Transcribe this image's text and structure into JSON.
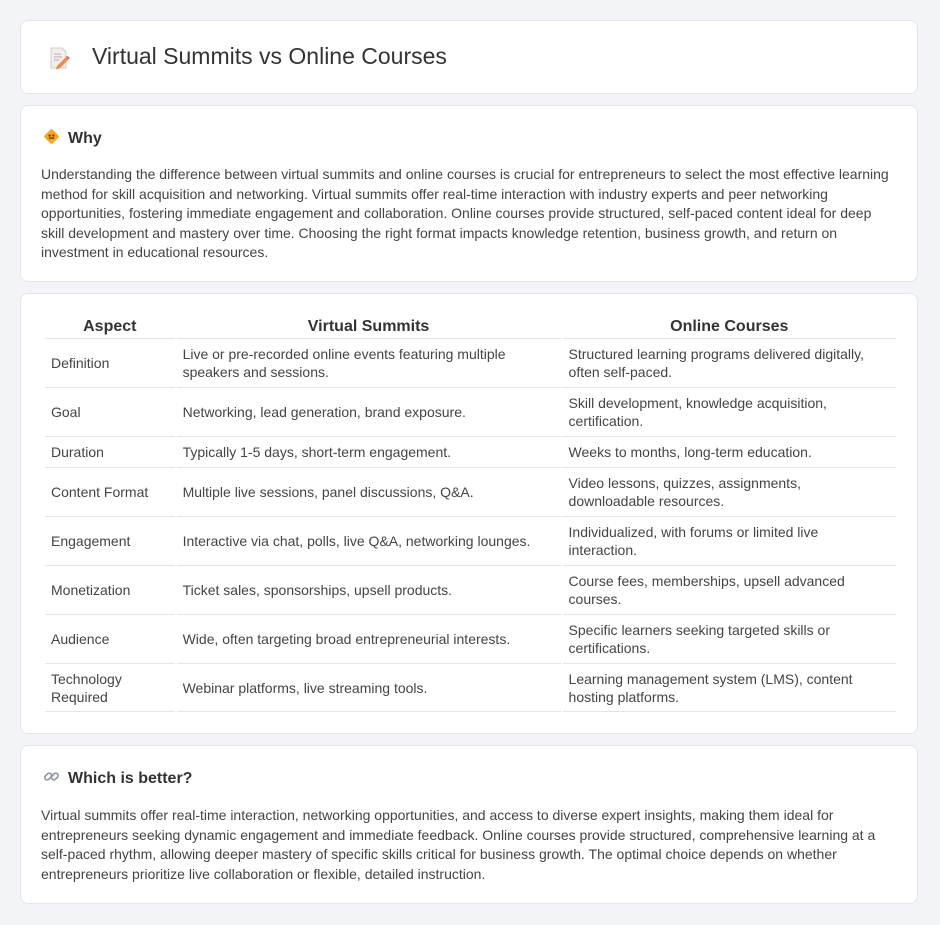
{
  "header": {
    "title": "Virtual Summits vs Online Courses",
    "icon": "document-pencil-icon"
  },
  "why": {
    "heading": "Why",
    "icon": "diamond-sign-icon",
    "text": "Understanding the difference between virtual summits and online courses is crucial for entrepreneurs to select the most effective learning method for skill acquisition and networking. Virtual summits offer real-time interaction with industry experts and peer networking opportunities, fostering immediate engagement and collaboration. Online courses provide structured, self-paced content ideal for deep skill development and mastery over time. Choosing the right format impacts knowledge retention, business growth, and return on investment in educational resources."
  },
  "table": {
    "headers": [
      "Aspect",
      "Virtual Summits",
      "Online Courses"
    ],
    "rows": [
      [
        "Definition",
        "Live or pre-recorded online events featuring multiple speakers and sessions.",
        "Structured learning programs delivered digitally, often self-paced."
      ],
      [
        "Goal",
        "Networking, lead generation, brand exposure.",
        "Skill development, knowledge acquisition, certification."
      ],
      [
        "Duration",
        "Typically 1-5 days, short-term engagement.",
        "Weeks to months, long-term education."
      ],
      [
        "Content Format",
        "Multiple live sessions, panel discussions, Q&A.",
        "Video lessons, quizzes, assignments, downloadable resources."
      ],
      [
        "Engagement",
        "Interactive via chat, polls, live Q&A, networking lounges.",
        "Individualized, with forums or limited live interaction."
      ],
      [
        "Monetization",
        "Ticket sales, sponsorships, upsell products.",
        "Course fees, memberships, upsell advanced courses."
      ],
      [
        "Audience",
        "Wide, often targeting broad entrepreneurial interests.",
        "Specific learners seeking targeted skills or certifications."
      ],
      [
        "Technology Required",
        "Webinar platforms, live streaming tools.",
        "Learning management system (LMS), content hosting platforms."
      ]
    ]
  },
  "better": {
    "heading": "Which is better?",
    "icon": "link-icon",
    "text": "Virtual summits offer real-time interaction, networking opportunities, and access to diverse expert insights, making them ideal for entrepreneurs seeking dynamic engagement and immediate feedback. Online courses provide structured, comprehensive learning at a self-paced rhythm, allowing deeper mastery of specific skills critical for business growth. The optimal choice depends on whether entrepreneurs prioritize live collaboration or flexible, detailed instruction."
  }
}
